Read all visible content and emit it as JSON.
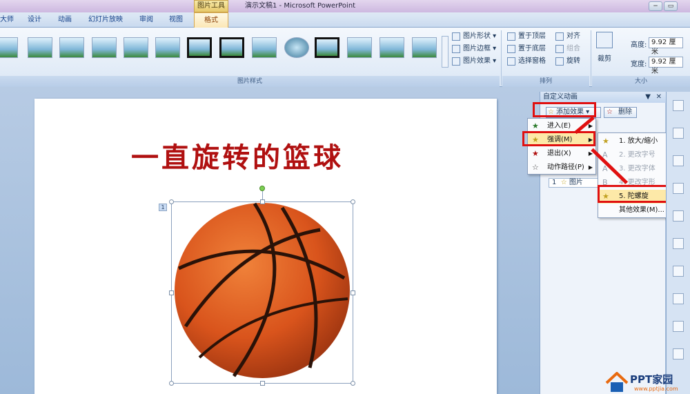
{
  "window": {
    "context_tab": "图片工具",
    "title": "演示文稿1 - Microsoft PowerPoint",
    "controls": [
      "−",
      "▭"
    ]
  },
  "tabs": [
    {
      "label": "大师"
    },
    {
      "label": "设计"
    },
    {
      "label": "动画"
    },
    {
      "label": "幻灯片放映"
    },
    {
      "label": "审阅"
    },
    {
      "label": "视图"
    },
    {
      "label": "格式"
    }
  ],
  "ribbon": {
    "picture_styles_label": "图片样式",
    "shape_btn": "图片形状",
    "border_btn": "图片边框",
    "effect_btn": "图片效果",
    "arrange": {
      "bring_front": "置于顶层",
      "send_back": "置于底层",
      "selection_pane": "选择窗格",
      "align": "对齐",
      "group": "组合",
      "rotate": "旋转",
      "label": "排列"
    },
    "crop_label": "裁剪",
    "size": {
      "height_label": "高度:",
      "height_value": "9.92 厘米",
      "width_label": "宽度:",
      "width_value": "9.92 厘米",
      "label": "大小"
    }
  },
  "slide": {
    "title": "一直旋转的篮球",
    "animation_marker": "1"
  },
  "pane": {
    "title": "自定义动画",
    "add_effect": "添加效果",
    "remove": "删除",
    "item_num": "1",
    "item_label": "图片"
  },
  "menu1": [
    {
      "label": "进入(E)",
      "icon": "enter-star-icon"
    },
    {
      "label": "强调(M)",
      "icon": "emphasis-star-icon"
    },
    {
      "label": "退出(X)",
      "icon": "exit-star-icon"
    },
    {
      "label": "动作路径(P)",
      "icon": "motion-path-icon"
    }
  ],
  "menu2": [
    {
      "label": "1. 放大/缩小",
      "disabled": false
    },
    {
      "label": "2. 更改字号",
      "disabled": true
    },
    {
      "label": "3. 更改字体",
      "disabled": true
    },
    {
      "label": "4. 更改字形",
      "disabled": true
    },
    {
      "label": "5. 陀螺旋",
      "disabled": false
    },
    {
      "label": "其他效果(M)...",
      "disabled": false
    }
  ],
  "watermark": {
    "text": "PPT家园",
    "url": "www.pptjia.com"
  },
  "colors": {
    "highlight": "#e01010",
    "title_red": "#b01010",
    "ribbon_blue": "#dbe7f5"
  }
}
